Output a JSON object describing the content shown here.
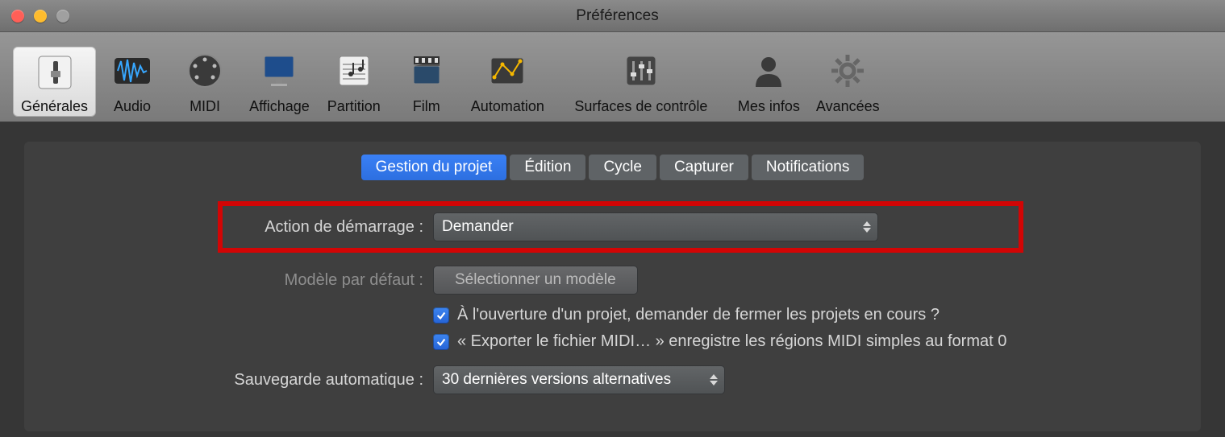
{
  "window": {
    "title": "Préférences"
  },
  "toolbar": {
    "items": [
      {
        "label": "Générales",
        "icon": "switch",
        "active": true
      },
      {
        "label": "Audio",
        "icon": "wave",
        "active": false
      },
      {
        "label": "MIDI",
        "icon": "midi",
        "active": false
      },
      {
        "label": "Affichage",
        "icon": "monitor",
        "active": false
      },
      {
        "label": "Partition",
        "icon": "score",
        "active": false
      },
      {
        "label": "Film",
        "icon": "film",
        "active": false
      },
      {
        "label": "Automation",
        "icon": "automation",
        "active": false
      },
      {
        "label": "Surfaces de contrôle",
        "icon": "mixer",
        "active": false
      },
      {
        "label": "Mes infos",
        "icon": "person",
        "active": false
      },
      {
        "label": "Avancées",
        "icon": "gear",
        "active": false
      }
    ]
  },
  "subtabs": [
    {
      "label": "Gestion du projet",
      "active": true
    },
    {
      "label": "Édition",
      "active": false
    },
    {
      "label": "Cycle",
      "active": false
    },
    {
      "label": "Capturer",
      "active": false
    },
    {
      "label": "Notifications",
      "active": false
    }
  ],
  "form": {
    "startup_label": "Action de démarrage :",
    "startup_value": "Demander",
    "template_label": "Modèle par défaut :",
    "template_button": "Sélectionner un modèle",
    "check1": "À l'ouverture d'un projet, demander de fermer les projets en cours ?",
    "check2": "« Exporter le fichier MIDI… » enregistre les régions MIDI simples au format 0",
    "autosave_label": "Sauvegarde automatique :",
    "autosave_value": "30 dernières versions alternatives"
  },
  "highlight_row": "startup"
}
